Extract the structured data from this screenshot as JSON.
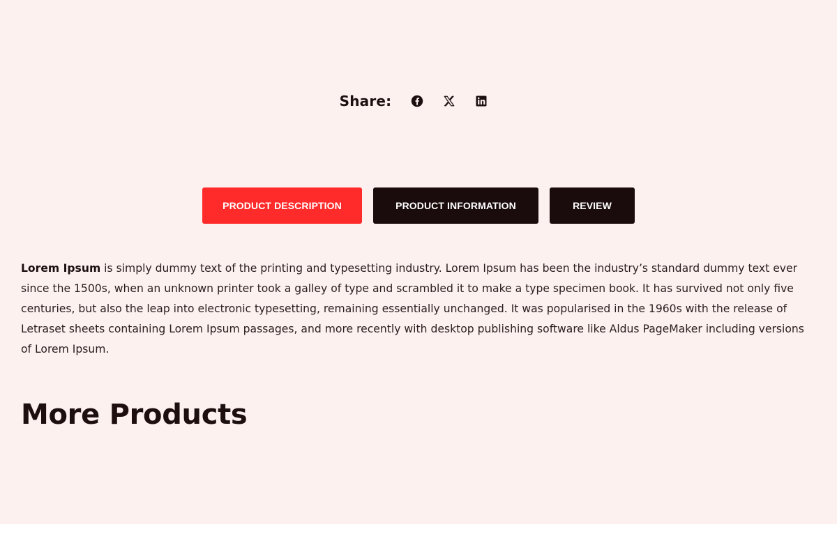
{
  "share": {
    "label": "Share:",
    "icons": [
      "facebook-icon",
      "x-twitter-icon",
      "linkedin-icon"
    ]
  },
  "tabs": [
    {
      "label": "PRODUCT DESCRIPTION",
      "active": true
    },
    {
      "label": "PRODUCT INFORMATION",
      "active": false
    },
    {
      "label": "REVIEW",
      "active": false
    }
  ],
  "description": {
    "lead": "Lorem Ipsum",
    "body": " is simply dummy text of the printing and typesetting industry. Lorem Ipsum has been the industry’s standard dummy text ever since the 1500s, when an unknown printer took a galley of type and scrambled it to make a type specimen book. It has survived not only five centuries, but also the leap into electronic typesetting, remaining essentially unchanged. It was popularised in the 1960s with the release of Letraset sheets containing Lorem Ipsum passages, and more recently with desktop publishing software like Aldus PageMaker including versions of Lorem Ipsum."
  },
  "more_products": {
    "title": "More Products"
  },
  "colors": {
    "background": "#fdf1ef",
    "active_tab": "#ff2a2a",
    "inactive_tab": "#1a0b0c",
    "text": "#1d0f10"
  }
}
